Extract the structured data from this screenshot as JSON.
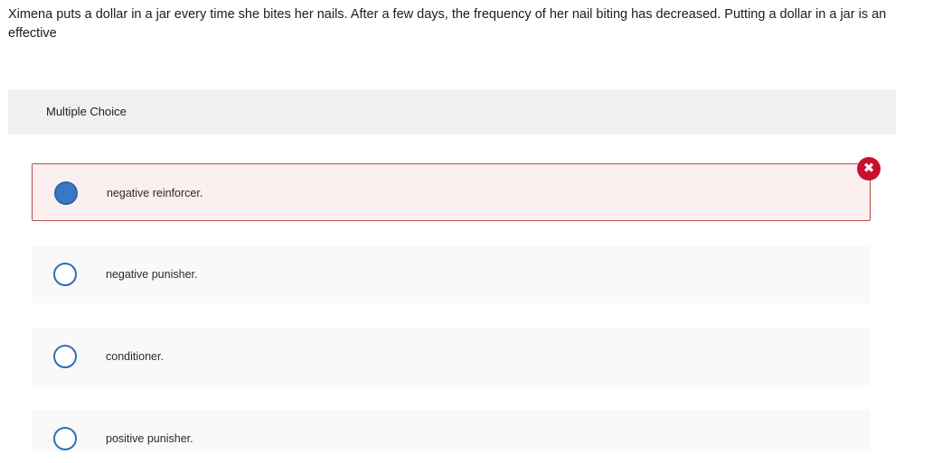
{
  "question": {
    "text": "Ximena puts a dollar in a jar every time she bites her nails.  After a few days, the frequency of her nail biting has decreased.  Putting a dollar in a jar is an effective"
  },
  "multiple_choice": {
    "title": "Multiple Choice",
    "options": [
      {
        "label": "negative reinforcer.",
        "selected": true,
        "status": "incorrect"
      },
      {
        "label": "negative punisher.",
        "selected": false
      },
      {
        "label": "conditioner.",
        "selected": false
      },
      {
        "label": "positive punisher.",
        "selected": false
      }
    ],
    "result_icon": "x-circle-icon",
    "colors": {
      "incorrect_border": "#b94a48",
      "incorrect_background": "#fbeff0",
      "radio_selected": "#3a78c4",
      "radio_border": "#2e6fb7",
      "wrong_badge": "#c8102e"
    }
  }
}
